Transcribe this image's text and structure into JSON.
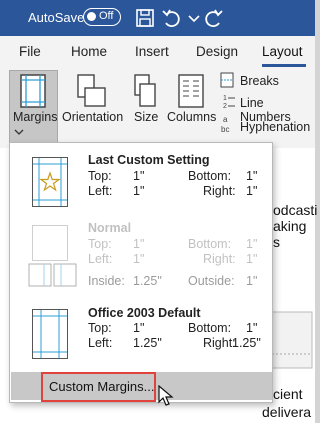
{
  "titlebar": {
    "autosave_label": "AutoSave",
    "toggle_state": "Off",
    "icons": [
      "save-icon",
      "undo-icon",
      "dropdown-caret-icon",
      "redo-icon"
    ]
  },
  "tabs": {
    "items": [
      "File",
      "Home",
      "Insert",
      "Design",
      "Layout"
    ],
    "active": "Layout"
  },
  "ribbon": {
    "margins_label": "Margins",
    "orientation_label": "Orientation",
    "size_label": "Size",
    "columns_label": "Columns",
    "breaks_label": "Breaks",
    "line_numbers_label": "Line Numbers",
    "hyphenation_label": "Hyphenation"
  },
  "document": {
    "fragments": [
      "odcasti",
      "aking s",
      "ficient",
      "delivera"
    ]
  },
  "margins_menu": {
    "options": [
      {
        "title": "Last Custom Setting",
        "top_label": "Top:",
        "top": "1\"",
        "bottom_label": "Bottom:",
        "bottom": "1\"",
        "left_label": "Left:",
        "left": "1\"",
        "right_label": "Right:",
        "right": "1\""
      },
      {
        "title": "Normal",
        "top_label": "Top:",
        "top": "1\"",
        "bottom_label": "Bottom:",
        "bottom": "1\"",
        "left_label": "Left:",
        "left": "1\"",
        "right_label": "Right:",
        "right": "1\""
      },
      {
        "inside_label": "Inside:",
        "inside": "1.25\"",
        "outside_label": "Outside:",
        "outside": "1\""
      },
      {
        "title": "Office 2003 Default",
        "top_label": "Top:",
        "top": "1\"",
        "bottom_label": "Bottom:",
        "bottom": "1\"",
        "left_label": "Left:",
        "left": "1.25\"",
        "right_label": "Right:",
        "right": "1.25\""
      }
    ],
    "custom_margins_label": "Custom Margins..."
  },
  "colors": {
    "titlebar_bg": "#2b579a",
    "highlight_border": "#e0423c",
    "margin_guide": "#2e9fd6"
  }
}
